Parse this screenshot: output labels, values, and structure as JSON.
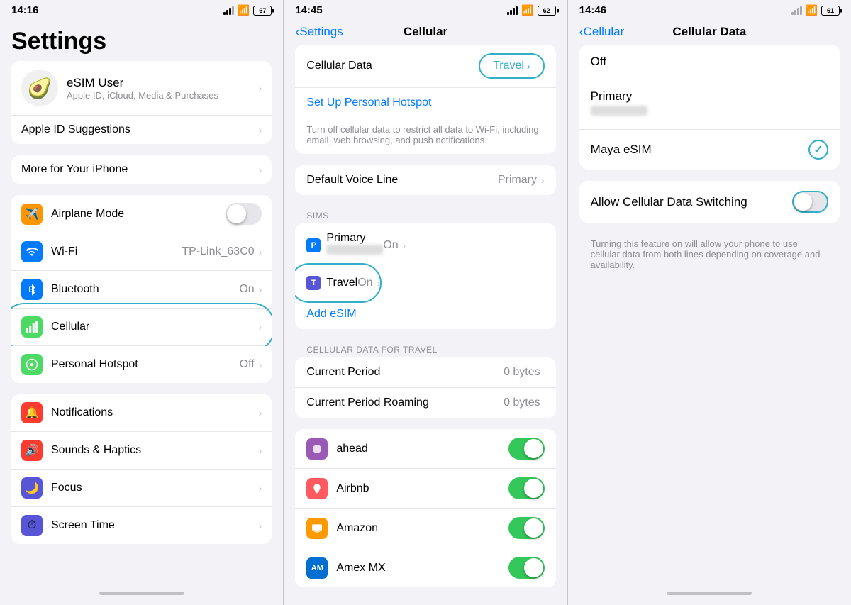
{
  "panel1": {
    "statusBar": {
      "time": "14:16",
      "battery": "67"
    },
    "title": "Settings",
    "profile": {
      "name": "eSIM User",
      "subtitle": "Apple ID, iCloud, Media & Purchases"
    },
    "suggestions": "Apple ID Suggestions",
    "moreForYouriPhone": "More for Your iPhone",
    "items": [
      {
        "label": "Airplane Mode",
        "icon": "✈",
        "iconBg": "#ff9500",
        "showToggle": true,
        "toggleOn": false
      },
      {
        "label": "Wi-Fi",
        "icon": "📶",
        "iconBg": "#007aff",
        "value": "TP-Link_63C0",
        "showChevron": true
      },
      {
        "label": "Bluetooth",
        "icon": "🔵",
        "iconBg": "#007aff",
        "value": "On",
        "showChevron": true
      },
      {
        "label": "Cellular",
        "icon": "📡",
        "iconBg": "#4cd964",
        "showChevron": true,
        "highlighted": true
      },
      {
        "label": "Personal Hotspot",
        "icon": "🔗",
        "iconBg": "#4cd964",
        "value": "Off",
        "showChevron": true
      }
    ],
    "section3": [
      {
        "label": "Notifications",
        "icon": "🔔",
        "iconBg": "#ff3b30",
        "showChevron": true
      },
      {
        "label": "Sounds & Haptics",
        "icon": "🔊",
        "iconBg": "#ff3b30",
        "showChevron": true
      },
      {
        "label": "Focus",
        "icon": "🌙",
        "iconBg": "#5856d6",
        "showChevron": true
      },
      {
        "label": "Screen Time",
        "icon": "⏱",
        "iconBg": "#5856d6",
        "showChevron": true
      }
    ]
  },
  "panel2": {
    "statusBar": {
      "time": "14:45",
      "battery": "62"
    },
    "backLabel": "Settings",
    "title": "Cellular",
    "cellularDataLabel": "Cellular Data",
    "cellularDataValue": "Travel",
    "setupHotspotLabel": "Set Up Personal Hotspot",
    "description": "Turn off cellular data to restrict all data to Wi-Fi, including email, web browsing, and push notifications.",
    "defaultVoiceLabel": "Default Voice Line",
    "defaultVoiceValue": "Primary",
    "simsHeader": "SIMs",
    "sims": [
      {
        "label": "Primary",
        "badge": "P",
        "badgeBg": "#007aff",
        "value": "On"
      },
      {
        "label": "Travel",
        "badge": "T",
        "badgeBg": "#5856d6",
        "value": "On",
        "highlighted": true
      }
    ],
    "addEsim": "Add eSIM",
    "cellularDataTravelHeader": "CELLULAR DATA FOR TRAVEL",
    "travelItems": [
      {
        "label": "Current Period",
        "value": "0 bytes"
      },
      {
        "label": "Current Period Roaming",
        "value": "0 bytes"
      }
    ],
    "apps": [
      {
        "label": "ahead",
        "icon": "🟣",
        "iconBg": "#9b59b6",
        "toggleOn": true
      },
      {
        "label": "Airbnb",
        "icon": "🔴",
        "iconBg": "#ff5a5f",
        "toggleOn": true
      },
      {
        "label": "Amazon",
        "icon": "📦",
        "iconBg": "#ff9900",
        "toggleOn": true
      },
      {
        "label": "Amex MX",
        "icon": "💳",
        "iconBg": "#006fcf",
        "toggleOn": true
      }
    ]
  },
  "panel3": {
    "statusBar": {
      "time": "14:46",
      "battery": "61"
    },
    "backLabel": "Cellular",
    "title": "Cellular Data",
    "options": [
      {
        "label": "Off",
        "selected": false
      },
      {
        "label": "Primary",
        "sublabel": true,
        "selected": false
      },
      {
        "label": "Maya eSIM",
        "selected": true
      }
    ],
    "allowSwitchingLabel": "Allow Cellular Data Switching",
    "allowSwitchingDescription": "Turning this feature on will allow your phone to use cellular data from both lines depending on coverage and availability."
  }
}
